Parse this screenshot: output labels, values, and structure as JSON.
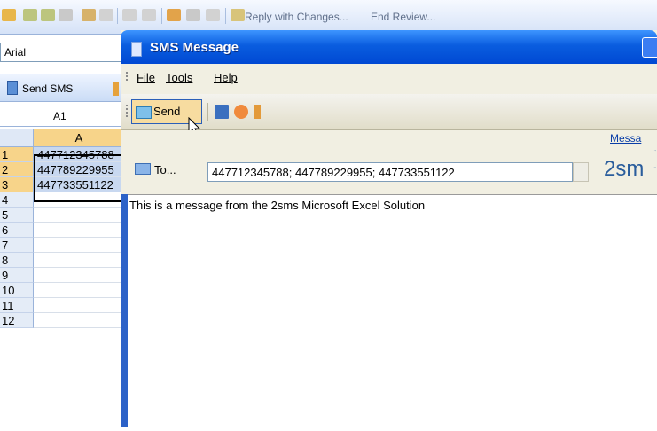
{
  "excel": {
    "toolbar_items": [
      "Reply with Changes...",
      "End Review..."
    ],
    "font_name": "Arial",
    "send_sms_label": "Send SMS",
    "name_box": "A1",
    "column_header": "A",
    "rows": [
      {
        "num": "1",
        "value": "447712345788",
        "selected": true
      },
      {
        "num": "2",
        "value": "447789229955",
        "selected": true
      },
      {
        "num": "3",
        "value": "447733551122",
        "selected": true
      },
      {
        "num": "4",
        "value": ""
      },
      {
        "num": "5",
        "value": ""
      },
      {
        "num": "6",
        "value": ""
      },
      {
        "num": "7",
        "value": ""
      },
      {
        "num": "8",
        "value": ""
      },
      {
        "num": "9",
        "value": ""
      },
      {
        "num": "10",
        "value": ""
      },
      {
        "num": "11",
        "value": ""
      },
      {
        "num": "12",
        "value": ""
      }
    ]
  },
  "dialog": {
    "title": "SMS Message",
    "menu": {
      "file": "File",
      "tools": "Tools",
      "help": "Help"
    },
    "toolbar": {
      "send": "Send"
    },
    "message_link": "Messa",
    "to_button": "To...",
    "to_value": "447712345788; 447789229955; 447733551122",
    "brand": "2sm",
    "message_body": "This is a message from the 2sms Microsoft Excel Solution"
  },
  "colors": {
    "title_bar": "#0a5ddf",
    "selection": "#f7d48a",
    "accent_link": "#0a3ea8"
  }
}
